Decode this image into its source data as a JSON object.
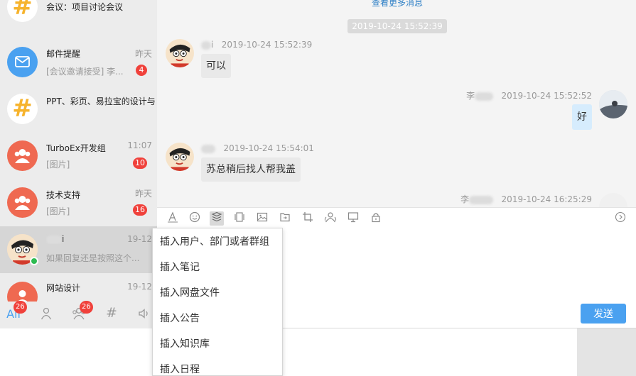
{
  "sidebar": {
    "conversations": [
      {
        "name": "会议：项目讨论会议",
        "time": "",
        "preview": "",
        "badge": "",
        "avatar": "hash-icon"
      },
      {
        "name": "邮件提醒",
        "time": "昨天",
        "preview": "[会议邀请接受] 李...",
        "badge": "4",
        "avatar": "mail-icon"
      },
      {
        "name": "PPT、彩页、易拉宝的设计与",
        "time": "",
        "preview": "",
        "badge": "",
        "avatar": "hash-icon"
      },
      {
        "name": "TurboEx开发组",
        "time": "11:07",
        "preview": "[图片]",
        "badge": "10",
        "avatar": "group-icon"
      },
      {
        "name": "技术支持",
        "time": "昨天",
        "preview": "[图片]",
        "badge": "16",
        "avatar": "group-icon"
      },
      {
        "name": "i",
        "time": "19-12",
        "preview": "如果回复还是按照这个...",
        "badge": "",
        "avatar": "cartoon-avatar"
      },
      {
        "name": "网站设计",
        "time": "19-12",
        "preview": "",
        "badge": "",
        "avatar": "group-icon"
      }
    ],
    "nav": {
      "all_label": "All",
      "all_badge": "26",
      "groups_badge": "26"
    }
  },
  "chat": {
    "load_more": "查看更多消息",
    "time_separator": "2019-10-24 15:52:39",
    "messages": [
      {
        "side": "left",
        "sender": "i",
        "time": "2019-10-24 15:52:39",
        "text": "可以"
      },
      {
        "side": "right",
        "sender": "李",
        "time": "2019-10-24 15:52:52",
        "text": "好"
      },
      {
        "side": "left",
        "sender": "",
        "time": "2019-10-24 15:54:01",
        "text": "苏总稍后找人帮我盖"
      },
      {
        "side": "right",
        "sender": "李",
        "time": "2019-10-24 16:25:29",
        "text": ""
      }
    ]
  },
  "toolbar": {
    "icons": [
      "font-icon",
      "emoji-icon",
      "insert-icon",
      "screenshot-icon",
      "image-icon",
      "file-icon",
      "crop-icon",
      "contacts-icon",
      "screen-share-icon",
      "lock-icon"
    ],
    "send_label": "发送"
  },
  "insert_menu": {
    "items": [
      "插入用户、部门或者群组",
      "插入笔记",
      "插入网盘文件",
      "插入公告",
      "插入知识库",
      "插入日程"
    ]
  },
  "colors": {
    "accent": "#4aa1f0",
    "badge": "#f0413b",
    "group_avatar": "#ef6951",
    "hash_icon": "#f6b32c"
  }
}
